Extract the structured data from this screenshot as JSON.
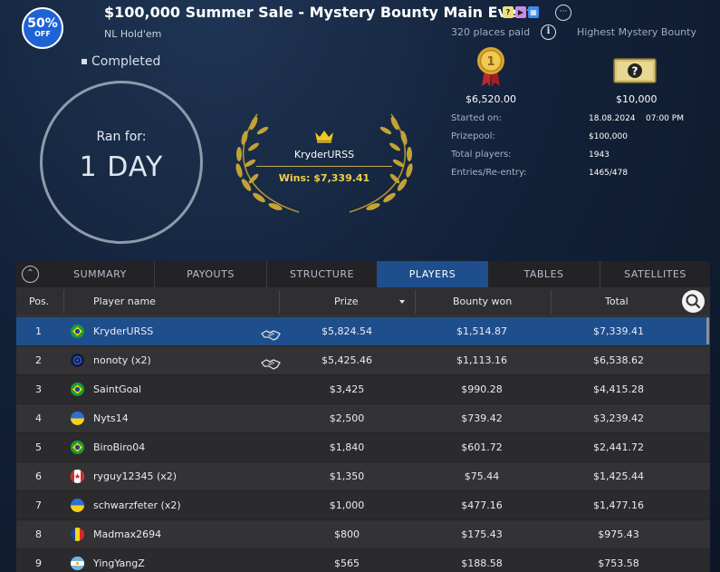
{
  "promo": {
    "percent": "50%",
    "off": "OFF"
  },
  "header": {
    "title": "$100,000 Summer Sale - Mystery Bounty Main Event",
    "game_type": "NL Hold'em",
    "places_paid": "320 places paid",
    "highest_bounty_label": "Highest Mystery Bounty",
    "title_icons": [
      "question-box-icon",
      "video-icon",
      "calendar-icon"
    ],
    "more_label": "···"
  },
  "status": "Completed",
  "ran_for": {
    "label": "Ran for:",
    "value": "1 DAY"
  },
  "winner": {
    "name": "KryderURSS",
    "wins": "Wins: $7,339.41"
  },
  "first_prize": "$6,520.00",
  "highest_bounty": "$10,000",
  "details": [
    {
      "label": "Started on:",
      "value": "18.08.2024    07:00 PM"
    },
    {
      "label": "Prizepool:",
      "value": "$100,000"
    },
    {
      "label": "Total players:",
      "value": "1943"
    },
    {
      "label": "Entries/Re-entry:",
      "value": "1465/478"
    }
  ],
  "tabs": [
    "SUMMARY",
    "PAYOUTS",
    "STRUCTURE",
    "PLAYERS",
    "TABLES",
    "SATELLITES"
  ],
  "active_tab": "PLAYERS",
  "columns": {
    "pos": "Pos.",
    "player": "Player name",
    "prize": "Prize",
    "bounty": "Bounty won",
    "total": "Total"
  },
  "players": [
    {
      "pos": "1",
      "flag": "brazil",
      "name": "KryderURSS",
      "deal": true,
      "prize": "$5,824.54",
      "bounty": "$1,514.87",
      "total": "$7,339.41"
    },
    {
      "pos": "2",
      "flag": "unknown",
      "name": "nonoty (x2)",
      "deal": true,
      "prize": "$5,425.46",
      "bounty": "$1,113.16",
      "total": "$6,538.62"
    },
    {
      "pos": "3",
      "flag": "brazil",
      "name": "SaintGoal",
      "deal": false,
      "prize": "$3,425",
      "bounty": "$990.28",
      "total": "$4,415.28"
    },
    {
      "pos": "4",
      "flag": "ukraine",
      "name": "Nyts14",
      "deal": false,
      "prize": "$2,500",
      "bounty": "$739.42",
      "total": "$3,239.42"
    },
    {
      "pos": "5",
      "flag": "brazil",
      "name": "BiroBiro04",
      "deal": false,
      "prize": "$1,840",
      "bounty": "$601.72",
      "total": "$2,441.72"
    },
    {
      "pos": "6",
      "flag": "canada",
      "name": "ryguy12345 (x2)",
      "deal": false,
      "prize": "$1,350",
      "bounty": "$75.44",
      "total": "$1,425.44"
    },
    {
      "pos": "7",
      "flag": "ukraine",
      "name": "schwarzfeter (x2)",
      "deal": false,
      "prize": "$1,000",
      "bounty": "$477.16",
      "total": "$1,477.16"
    },
    {
      "pos": "8",
      "flag": "romania",
      "name": "Madmax2694",
      "deal": false,
      "prize": "$800",
      "bounty": "$175.43",
      "total": "$975.43"
    },
    {
      "pos": "9",
      "flag": "argentina",
      "name": "YingYangZ",
      "deal": false,
      "prize": "$565",
      "bounty": "$188.58",
      "total": "$753.58"
    }
  ],
  "colors": {
    "accent": "#1f4e8c",
    "gold": "#f0cf4a",
    "panel": "#2b2b2e"
  }
}
